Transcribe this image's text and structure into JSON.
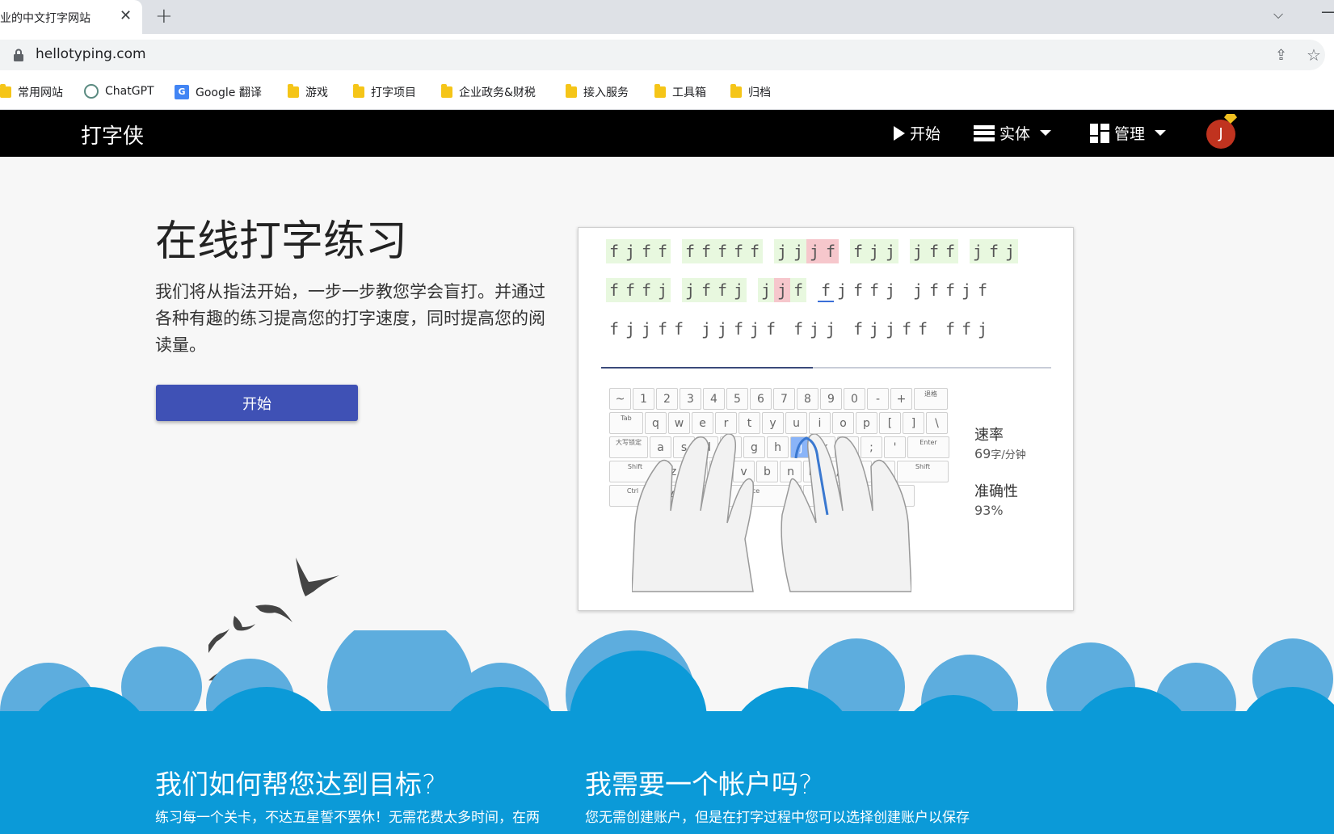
{
  "browser": {
    "tab_title": "业的中文打字网站",
    "url": "hellotyping.com",
    "bookmarks": [
      {
        "label": "常用网站",
        "icon": "folder-icon"
      },
      {
        "label": "ChatGPT",
        "icon": "chatgpt-icon"
      },
      {
        "label": "Google 翻译",
        "icon": "google-translate-icon"
      },
      {
        "label": "游戏",
        "icon": "folder-icon"
      },
      {
        "label": "打字项目",
        "icon": "folder-icon"
      },
      {
        "label": "企业政务&财税",
        "icon": "folder-icon"
      },
      {
        "label": "接入服务",
        "icon": "folder-icon"
      },
      {
        "label": "工具箱",
        "icon": "folder-icon"
      },
      {
        "label": "归档",
        "icon": "folder-icon"
      }
    ]
  },
  "nav": {
    "logo": "打字侠",
    "start": "开始",
    "entity": "实体",
    "manage": "管理",
    "avatar_initial": "J",
    "bg": "#000000"
  },
  "hero": {
    "title": "在线打字练习",
    "description": "我们将从指法开始，一步一步教您学会盲打。并通过各种有趣的练习提高您的打字速度，同时提高您的阅读量。",
    "button": "开始",
    "button_color": "#3f51b5"
  },
  "demo": {
    "lines": [
      {
        "words": [
          "fjff",
          "fffff",
          "jjjf",
          "fjj",
          "jff",
          "jfj"
        ]
      },
      {
        "words": [
          "fffj",
          "jffj",
          "jjf",
          "fjffj",
          "jffjf"
        ]
      },
      {
        "words": [
          "fjjff",
          "jjfjf",
          "fjj",
          "fjjff",
          "ffj"
        ]
      }
    ],
    "progress": 0.47,
    "stats": {
      "speed_label": "速率",
      "speed_value": "69",
      "speed_unit": "字/分钟",
      "accuracy_label": "准确性",
      "accuracy_value": "93%"
    },
    "active_key": "j"
  },
  "bottom": {
    "bg": "#0b9ad8",
    "col1_title": "我们如何帮您达到目标?",
    "col1_text": "练习每一个关卡，不达五星誓不罢休！无需花费太多时间，在两",
    "col2_title": "我需要一个帐户吗?",
    "col2_text": "您无需创建账户，但是在打字过程中您可以选择创建账户以保存"
  }
}
